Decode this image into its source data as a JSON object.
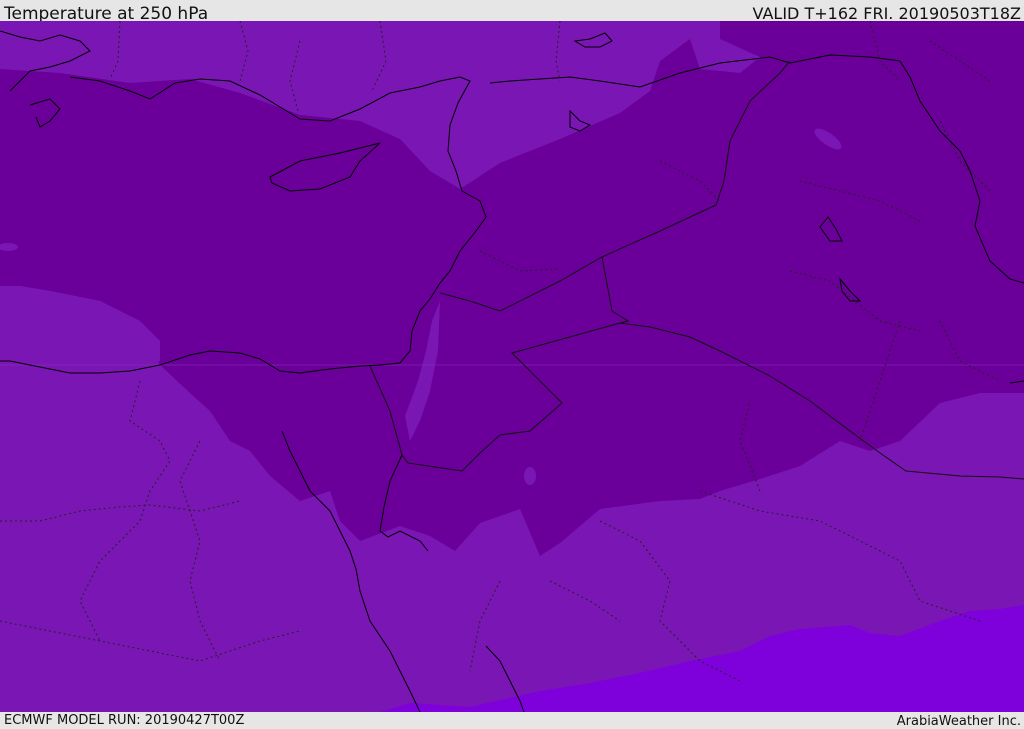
{
  "header": {
    "title": "Temperature at 250 hPa",
    "valid": "VALID T+162 FRI. 20190503T18Z"
  },
  "footer": {
    "model_run": "ECMWF MODEL RUN: 20190427T00Z",
    "credit": "ArabiaWeather Inc."
  },
  "map": {
    "colors": {
      "background_band": "#7a16b3",
      "cold_core": "#6a0099",
      "warm_band": "#7e00da",
      "coastline": "#000000",
      "border": "#1a1a1a"
    }
  }
}
